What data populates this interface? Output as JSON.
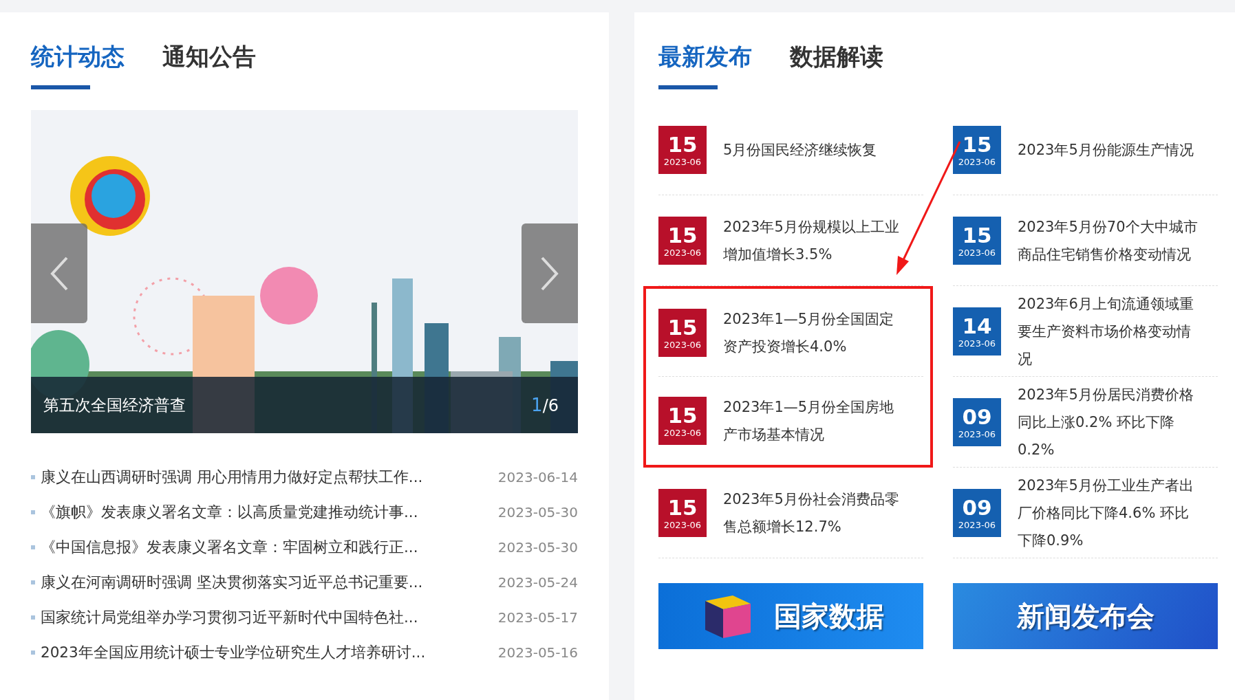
{
  "left_panel": {
    "tabs": [
      {
        "label": "统计动态",
        "selected": true
      },
      {
        "label": "通知公告",
        "selected": false
      }
    ],
    "carousel": {
      "caption": "第五次全国经济普查",
      "current": "1",
      "total": "/6"
    },
    "news": [
      {
        "title": "康义在山西调研时强调 用心用情用力做好定点帮扶工作...",
        "date": "2023-06-14"
      },
      {
        "title": "《旗帜》发表康义署名文章：以高质量党建推动统计事...",
        "date": "2023-05-30"
      },
      {
        "title": "《中国信息报》发表康义署名文章：牢固树立和践行正...",
        "date": "2023-05-30"
      },
      {
        "title": "康义在河南调研时强调 坚决贯彻落实习近平总书记重要...",
        "date": "2023-05-24"
      },
      {
        "title": "国家统计局党组举办学习贯彻习近平新时代中国特色社...",
        "date": "2023-05-17"
      },
      {
        "title": "2023年全国应用统计硕士专业学位研究生人才培养研讨...",
        "date": "2023-05-16"
      }
    ]
  },
  "right_panel": {
    "tabs": [
      {
        "label": "最新发布",
        "selected": true
      },
      {
        "label": "数据解读",
        "selected": false
      }
    ],
    "columns": [
      {
        "items": [
          {
            "day": "15",
            "date": "2023-06",
            "title": "5月份国民经济继续恢复",
            "color": "#b8102a",
            "highlighted": false
          },
          {
            "day": "15",
            "date": "2023-06",
            "title": "2023年5月份规模以上工业增加值增长3.5%",
            "color": "#b8102a",
            "highlighted": false
          },
          {
            "day": "15",
            "date": "2023-06",
            "title": "2023年1—5月份全国固定资产投资增长4.0%",
            "color": "#b8102a",
            "highlighted": true
          },
          {
            "day": "15",
            "date": "2023-06",
            "title": "2023年1—5月份全国房地产市场基本情况",
            "color": "#b8102a",
            "highlighted": true
          },
          {
            "day": "15",
            "date": "2023-06",
            "title": "2023年5月份社会消费品零售总额增长12.7%",
            "color": "#b8102a",
            "highlighted": false
          }
        ]
      },
      {
        "items": [
          {
            "day": "15",
            "date": "2023-06",
            "title": "2023年5月份能源生产情况",
            "color": "#1560b0",
            "highlighted": false
          },
          {
            "day": "15",
            "date": "2023-06",
            "title": "2023年5月份70个大中城市商品住宅销售价格变动情况",
            "color": "#1560b0",
            "highlighted": false
          },
          {
            "day": "14",
            "date": "2023-06",
            "title": "2023年6月上旬流通领域重要生产资料市场价格变动情况",
            "color": "#1560b0",
            "highlighted": false
          },
          {
            "day": "09",
            "date": "2023-06",
            "title": "2023年5月份居民消费价格同比上涨0.2% 环比下降0.2%",
            "color": "#1560b0",
            "highlighted": false
          },
          {
            "day": "09",
            "date": "2023-06",
            "title": "2023年5月份工业生产者出厂价格同比下降4.6% 环比下降0.9%",
            "color": "#1560b0",
            "highlighted": false
          }
        ]
      }
    ],
    "banners": [
      {
        "kind": "data",
        "label": "国家数据"
      },
      {
        "kind": "press",
        "label": "新闻发布会"
      }
    ],
    "annotation": {
      "arrow": true
    }
  }
}
